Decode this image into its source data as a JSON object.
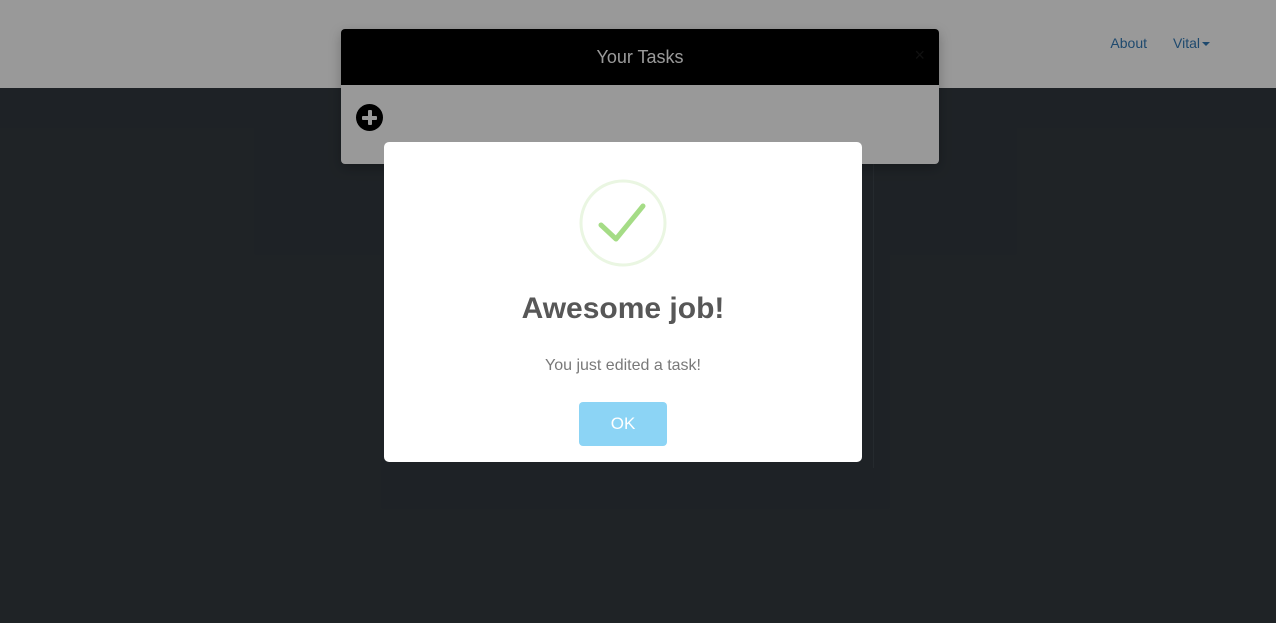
{
  "navbar": {
    "links": [
      {
        "label": "About"
      },
      {
        "label": "Vital"
      }
    ]
  },
  "tasks_modal": {
    "title": "Your Tasks",
    "close_label": "×"
  },
  "alert": {
    "icon": "success-check-icon",
    "title": "Awesome job!",
    "text": "You just edited a task!",
    "ok_label": "OK",
    "colors": {
      "check": "#a5dc86",
      "button": "#8cd4f5"
    }
  }
}
